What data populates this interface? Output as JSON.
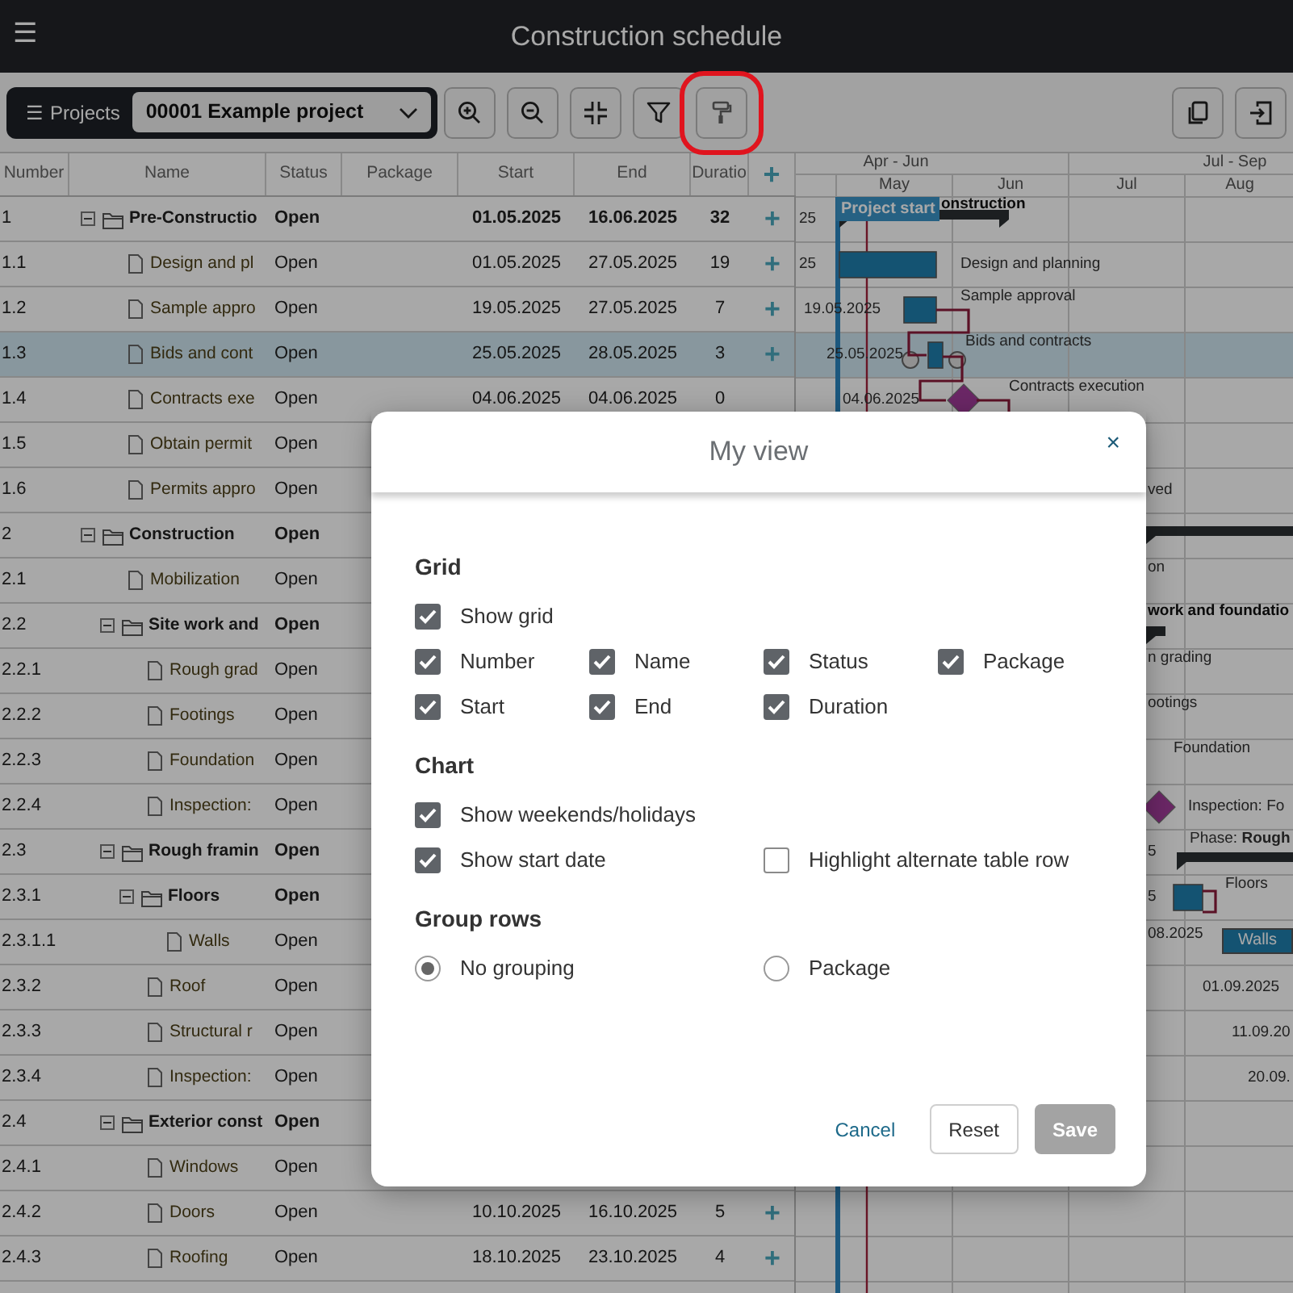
{
  "app_bar": {
    "menu": "☰",
    "title": "Construction schedule"
  },
  "toolbar": {
    "projects_label": "Projects",
    "projects_menu": "☰",
    "project": "00001 Example project",
    "buttons": [
      {
        "kind": "zoom-in",
        "highlighted": false
      },
      {
        "kind": "zoom-out",
        "highlighted": false
      },
      {
        "kind": "collapse",
        "highlighted": false
      },
      {
        "kind": "filter",
        "highlighted": false
      },
      {
        "kind": "paint-roller",
        "highlighted": true
      }
    ],
    "right_buttons": [
      {
        "kind": "copy"
      },
      {
        "kind": "export"
      }
    ]
  },
  "table": {
    "columns": [
      "Number",
      "Name",
      "Status",
      "Package",
      "Start",
      "End",
      "Duratio",
      "+"
    ],
    "rows": [
      {
        "number": "1",
        "name": "Pre-Constructio",
        "status": "Open",
        "start": "01.05.2025",
        "end": "16.06.2025",
        "duration": "32",
        "add": "+",
        "selected": false,
        "expanded": true,
        "gantt": [
          {
            "kind": "date",
            "text": "25"
          },
          {
            "kind": "summary"
          },
          {
            "kind": "bold-label",
            "text": "onstruction"
          }
        ],
        "children": [
          {
            "number": "1.1",
            "name": "Design and pl",
            "status": "Open",
            "start": "01.05.2025",
            "end": "27.05.2025",
            "duration": "19",
            "add": "+",
            "selected": false,
            "gantt": [
              {
                "kind": "date",
                "text": "25"
              },
              {
                "kind": "bar"
              },
              {
                "kind": "label",
                "text": "Design and planning"
              }
            ]
          },
          {
            "number": "1.2",
            "name": "Sample appro",
            "status": "Open",
            "start": "19.05.2025",
            "end": "27.05.2025",
            "duration": "7",
            "add": "+",
            "selected": false,
            "gantt": [
              {
                "kind": "date",
                "text": "19.05.2025"
              },
              {
                "kind": "bar"
              },
              {
                "kind": "label",
                "text": "Sample approval"
              }
            ]
          },
          {
            "number": "1.3",
            "name": "Bids and cont",
            "status": "Open",
            "start": "25.05.2025",
            "end": "28.05.2025",
            "duration": "3",
            "add": "+",
            "selected": true,
            "gantt": [
              {
                "kind": "date",
                "text": "25.05.2025"
              },
              {
                "kind": "bar"
              },
              {
                "kind": "label",
                "text": "Bids and contracts"
              }
            ]
          },
          {
            "number": "1.4",
            "name": "Contracts exe",
            "status": "Open",
            "start": "04.06.2025",
            "end": "04.06.2025",
            "duration": "0",
            "selected": false,
            "gantt": [
              {
                "kind": "date",
                "text": "04.06.2025"
              },
              {
                "kind": "milestone"
              },
              {
                "kind": "label",
                "text": "Contracts execution"
              }
            ]
          },
          {
            "number": "1.5",
            "name": "Obtain permit",
            "status": "Open",
            "selected": false
          },
          {
            "number": "1.6",
            "name": "Permits appro",
            "status": "Open",
            "selected": false,
            "gantt": [
              {
                "kind": "label",
                "text": "ved"
              }
            ]
          }
        ]
      },
      {
        "number": "2",
        "name": "Construction",
        "status": "Open",
        "selected": false,
        "expanded": true,
        "gantt": [
          {
            "kind": "summary"
          }
        ],
        "children": [
          {
            "number": "2.1",
            "name": "Mobilization",
            "status": "Open",
            "selected": false,
            "gantt": [
              {
                "kind": "label",
                "text": "on"
              }
            ]
          },
          {
            "number": "2.2",
            "name": "Site work and",
            "status": "Open",
            "selected": false,
            "expanded": true,
            "gantt": [
              {
                "kind": "bold-label",
                "text": "work and foundatio"
              },
              {
                "kind": "summary"
              }
            ],
            "children": [
              {
                "number": "2.2.1",
                "name": "Rough grad",
                "status": "Open",
                "selected": false,
                "gantt": [
                  {
                    "kind": "label",
                    "text": "n grading"
                  }
                ]
              },
              {
                "number": "2.2.2",
                "name": "Footings",
                "status": "Open",
                "selected": false,
                "gantt": [
                  {
                    "kind": "label",
                    "text": "ootings"
                  }
                ]
              },
              {
                "number": "2.2.3",
                "name": "Foundation",
                "status": "Open",
                "selected": false,
                "gantt": [
                  {
                    "kind": "label",
                    "text": "Foundation"
                  }
                ]
              },
              {
                "number": "2.2.4",
                "name": "Inspection:",
                "status": "Open",
                "selected": false,
                "gantt": [
                  {
                    "kind": "milestone"
                  },
                  {
                    "kind": "label",
                    "text": "Inspection: Fo"
                  }
                ]
              }
            ]
          },
          {
            "number": "2.3",
            "name": "Rough framin",
            "status": "Open",
            "selected": false,
            "expanded": true,
            "gantt": [
              {
                "kind": "date",
                "text": "5"
              },
              {
                "kind": "label",
                "text": "Phase: **Rough**"
              },
              {
                "kind": "summary"
              }
            ],
            "children": [
              {
                "number": "2.3.1",
                "name": "Floors",
                "status": "Open",
                "selected": false,
                "expanded": true,
                "gantt": [
                  {
                    "kind": "date",
                    "text": "5"
                  },
                  {
                    "kind": "bar"
                  },
                  {
                    "kind": "label",
                    "text": "Floors"
                  }
                ],
                "children": [
                  {
                    "number": "2.3.1.1",
                    "name": "Walls",
                    "status": "Open",
                    "selected": false,
                    "gantt": [
                      {
                        "kind": "date",
                        "text": "08.2025"
                      },
                      {
                        "kind": "labeled-bar",
                        "text": "Walls"
                      }
                    ]
                  }
                ]
              },
              {
                "number": "2.3.2",
                "name": "Roof",
                "status": "Open",
                "selected": false,
                "gantt": [
                  {
                    "kind": "date",
                    "text": "01.09.2025"
                  }
                ]
              },
              {
                "number": "2.3.3",
                "name": "Structural r",
                "status": "Open",
                "selected": false,
                "gantt": [
                  {
                    "kind": "date",
                    "text": "11.09.20"
                  }
                ]
              },
              {
                "number": "2.3.4",
                "name": "Inspection:",
                "status": "Open",
                "selected": false,
                "gantt": [
                  {
                    "kind": "date",
                    "text": "20.09."
                  }
                ]
              }
            ]
          },
          {
            "number": "2.4",
            "name": "Exterior const",
            "status": "Open",
            "selected": false,
            "expanded": true,
            "children": [
              {
                "number": "2.4.1",
                "name": "Windows",
                "status": "Open",
                "selected": false
              },
              {
                "number": "2.4.2",
                "name": "Doors",
                "status": "Open",
                "start": "10.10.2025",
                "end": "16.10.2025",
                "duration": "5",
                "add": "+",
                "selected": false
              },
              {
                "number": "2.4.3",
                "name": "Roofing",
                "status": "Open",
                "start": "18.10.2025",
                "end": "23.10.2025",
                "duration": "4",
                "add": "+",
                "selected": false
              }
            ]
          }
        ]
      }
    ]
  },
  "gantt_header": {
    "quarters": [
      "Apr - Jun",
      "Jul - Sep"
    ],
    "months": [
      "May",
      "Jun",
      "Jul",
      "Aug"
    ],
    "project_start": "Project start"
  },
  "dialog": {
    "title": "My view",
    "close": "×",
    "sections": [
      {
        "title": "Grid",
        "rows": [
          [
            {
              "kind": "checkbox",
              "label": "Show grid",
              "checked": true
            }
          ],
          [
            {
              "kind": "checkbox",
              "label": "Number",
              "checked": true
            },
            {
              "kind": "checkbox",
              "label": "Name",
              "checked": true
            },
            {
              "kind": "checkbox",
              "label": "Status",
              "checked": true
            },
            {
              "kind": "checkbox",
              "label": "Package",
              "checked": true
            }
          ],
          [
            {
              "kind": "checkbox",
              "label": "Start",
              "checked": true
            },
            {
              "kind": "checkbox",
              "label": "End",
              "checked": true
            },
            {
              "kind": "checkbox",
              "label": "Duration",
              "checked": true
            }
          ]
        ]
      },
      {
        "title": "Chart",
        "rows": [
          [
            {
              "kind": "checkbox",
              "label": "Show weekends/holidays",
              "checked": true
            }
          ],
          [
            {
              "kind": "checkbox",
              "label": "Show start date",
              "checked": true
            },
            {
              "kind": "checkbox",
              "label": "Highlight alternate table row",
              "checked": false
            }
          ]
        ]
      },
      {
        "title": "Group rows",
        "rows": [
          [
            {
              "kind": "radio",
              "label": "No grouping",
              "selected": true
            },
            {
              "kind": "radio",
              "label": "Package",
              "selected": false
            }
          ]
        ]
      }
    ],
    "buttons": [
      {
        "kind": "link",
        "label": "Cancel"
      },
      {
        "kind": "outline",
        "label": "Reset"
      },
      {
        "kind": "primary",
        "label": "Save",
        "disabled": true
      }
    ]
  }
}
